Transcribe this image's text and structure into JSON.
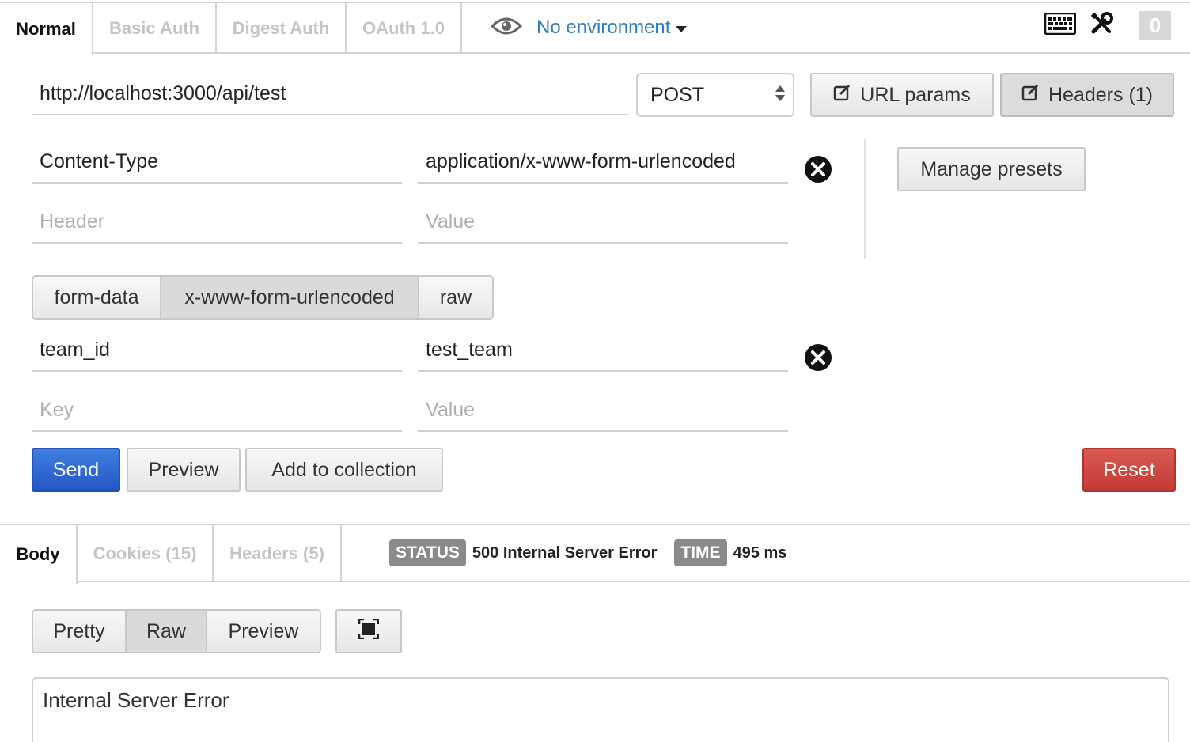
{
  "request_tabs": [
    "Normal",
    "Basic Auth",
    "Digest Auth",
    "OAuth 1.0"
  ],
  "environment": {
    "label": "No environment",
    "icon": "eye-icon"
  },
  "toolbar": {
    "keyboard_icon": "keyboard-icon",
    "tools_icon": "wrench-tools-icon",
    "count": "0"
  },
  "url": {
    "value": "http://localhost:3000/api/test"
  },
  "method": {
    "selected": "POST"
  },
  "buttons": {
    "url_params": "URL params",
    "headers": "Headers (1)",
    "manage_presets": "Manage presets",
    "send": "Send",
    "preview": "Preview",
    "add_to_collection": "Add to collection",
    "reset": "Reset"
  },
  "headers": {
    "rows": [
      {
        "key": "Content-Type",
        "value": "application/x-www-form-urlencoded"
      }
    ],
    "placeholders": {
      "key": "Header",
      "value": "Value"
    }
  },
  "body_modes": [
    "form-data",
    "x-www-form-urlencoded",
    "raw"
  ],
  "body_mode_selected": "x-www-form-urlencoded",
  "params": {
    "rows": [
      {
        "key": "team_id",
        "value": "test_team"
      }
    ],
    "placeholders": {
      "key": "Key",
      "value": "Value"
    }
  },
  "response_tabs": [
    "Body",
    "Cookies (15)",
    "Headers (5)"
  ],
  "response_status": {
    "status_label": "STATUS",
    "status_value": "500 Internal Server Error",
    "time_label": "TIME",
    "time_value": "495 ms"
  },
  "view_modes": [
    "Pretty",
    "Raw",
    "Preview"
  ],
  "view_mode_selected": "Raw",
  "response_body": "Internal Server Error",
  "colors": {
    "accent_blue": "#2d7fc1",
    "send": "#2457c5",
    "reset": "#c23b33"
  }
}
